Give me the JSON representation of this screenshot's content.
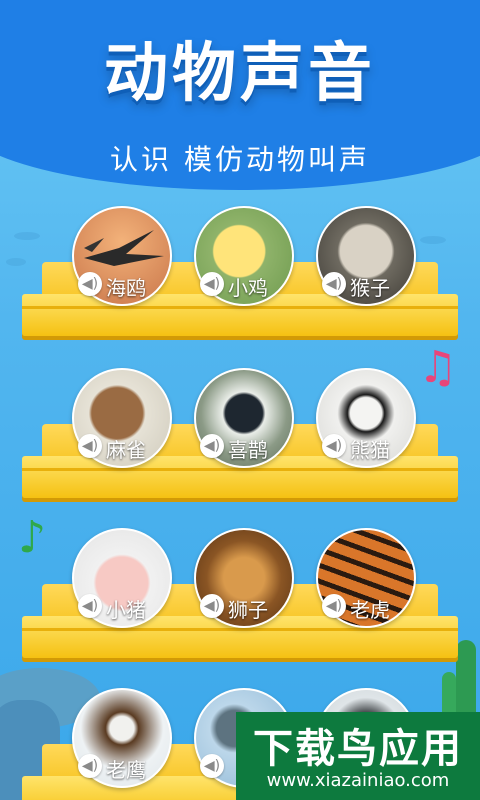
{
  "header": {
    "title": "动物声音",
    "subtitle": "认识 模仿动物叫声"
  },
  "animals": [
    {
      "label": "海鸥",
      "icon": "seagull-photo"
    },
    {
      "label": "小鸡",
      "icon": "chick-photo"
    },
    {
      "label": "猴子",
      "icon": "monkey-photo"
    },
    {
      "label": "麻雀",
      "icon": "sparrow-photo"
    },
    {
      "label": "喜鹊",
      "icon": "magpie-photo"
    },
    {
      "label": "熊猫",
      "icon": "panda-photo"
    },
    {
      "label": "小猪",
      "icon": "piglet-photo"
    },
    {
      "label": "狮子",
      "icon": "lion-photo"
    },
    {
      "label": "老虎",
      "icon": "tiger-photo"
    },
    {
      "label": "老鹰",
      "icon": "eagle-photo"
    },
    {
      "label": "",
      "icon": "dolphin-photo"
    },
    {
      "label": "",
      "icon": "penguin-photo"
    }
  ],
  "sound_icon": "speaker-icon",
  "watermark": {
    "title": "下载鸟应用",
    "url": "www.xiazainiao.com"
  },
  "colors": {
    "header_blue": "#1f7fe6",
    "shelf_yellow": "#f6c21c",
    "note_pink": "#e8457a",
    "note_green": "#2fa84a"
  }
}
